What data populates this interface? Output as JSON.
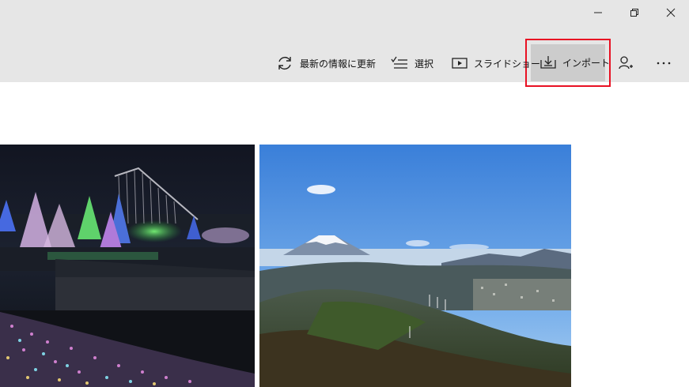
{
  "window": {
    "minimize_icon": "minimize-icon",
    "maximize_icon": "restore-icon",
    "close_icon": "close-icon"
  },
  "toolbar": {
    "refresh_label": "最新の情報に更新",
    "select_label": "選択",
    "slideshow_label": "スライドショー",
    "import_label": "インポート",
    "add_person_icon": "add-person-icon",
    "more_icon": "more-icon"
  },
  "photos": [
    {
      "description_icon": "illumination-photo"
    },
    {
      "description_icon": "mountain-photo"
    }
  ],
  "colors": {
    "titlebar_bg": "#e6e6e6",
    "highlight_border": "#e81123",
    "import_bg": "#cccccc"
  }
}
